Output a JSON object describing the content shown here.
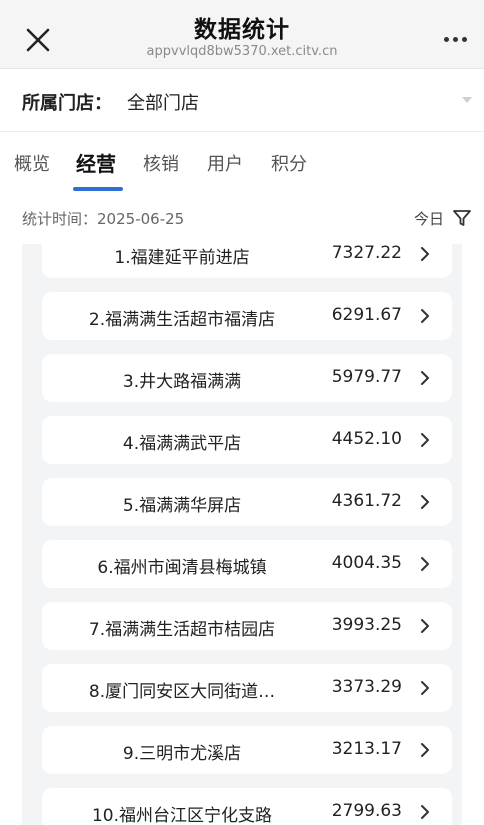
{
  "header": {
    "title": "数据统计",
    "subtitle": "appvvlqd8bw5370.xet.citv.cn"
  },
  "store": {
    "label": "所属门店：",
    "value": "全部门店"
  },
  "tabs": [
    {
      "label": "概览"
    },
    {
      "label": "经营"
    },
    {
      "label": "核销"
    },
    {
      "label": "用户"
    },
    {
      "label": "积分"
    }
  ],
  "active_tab": "经营",
  "date": {
    "label": "统计时间：",
    "value": "2025-06-25",
    "range_label": "今日"
  },
  "colors": {
    "accent": "#2e6fd6",
    "list_background": "#f3f4f6"
  },
  "rows": [
    {
      "name": "1.福建延平前进店",
      "value": "7327.22"
    },
    {
      "name": "2.福满满生活超市福清店",
      "value": "6291.67"
    },
    {
      "name": "3.井大路福满满",
      "value": "5979.77"
    },
    {
      "name": "4.福满满武平店",
      "value": "4452.10"
    },
    {
      "name": "5.福满满华屏店",
      "value": "4361.72"
    },
    {
      "name": "6.福州市闽清县梅城镇",
      "value": "4004.35"
    },
    {
      "name": "7.福满满生活超市桔园店",
      "value": "3993.25"
    },
    {
      "name": "8.厦门同安区大同街道…",
      "value": "3373.29"
    },
    {
      "name": "9.三明市尤溪店",
      "value": "3213.17"
    },
    {
      "name": "10.福州台江区宁化支路",
      "value": "2799.63"
    }
  ]
}
